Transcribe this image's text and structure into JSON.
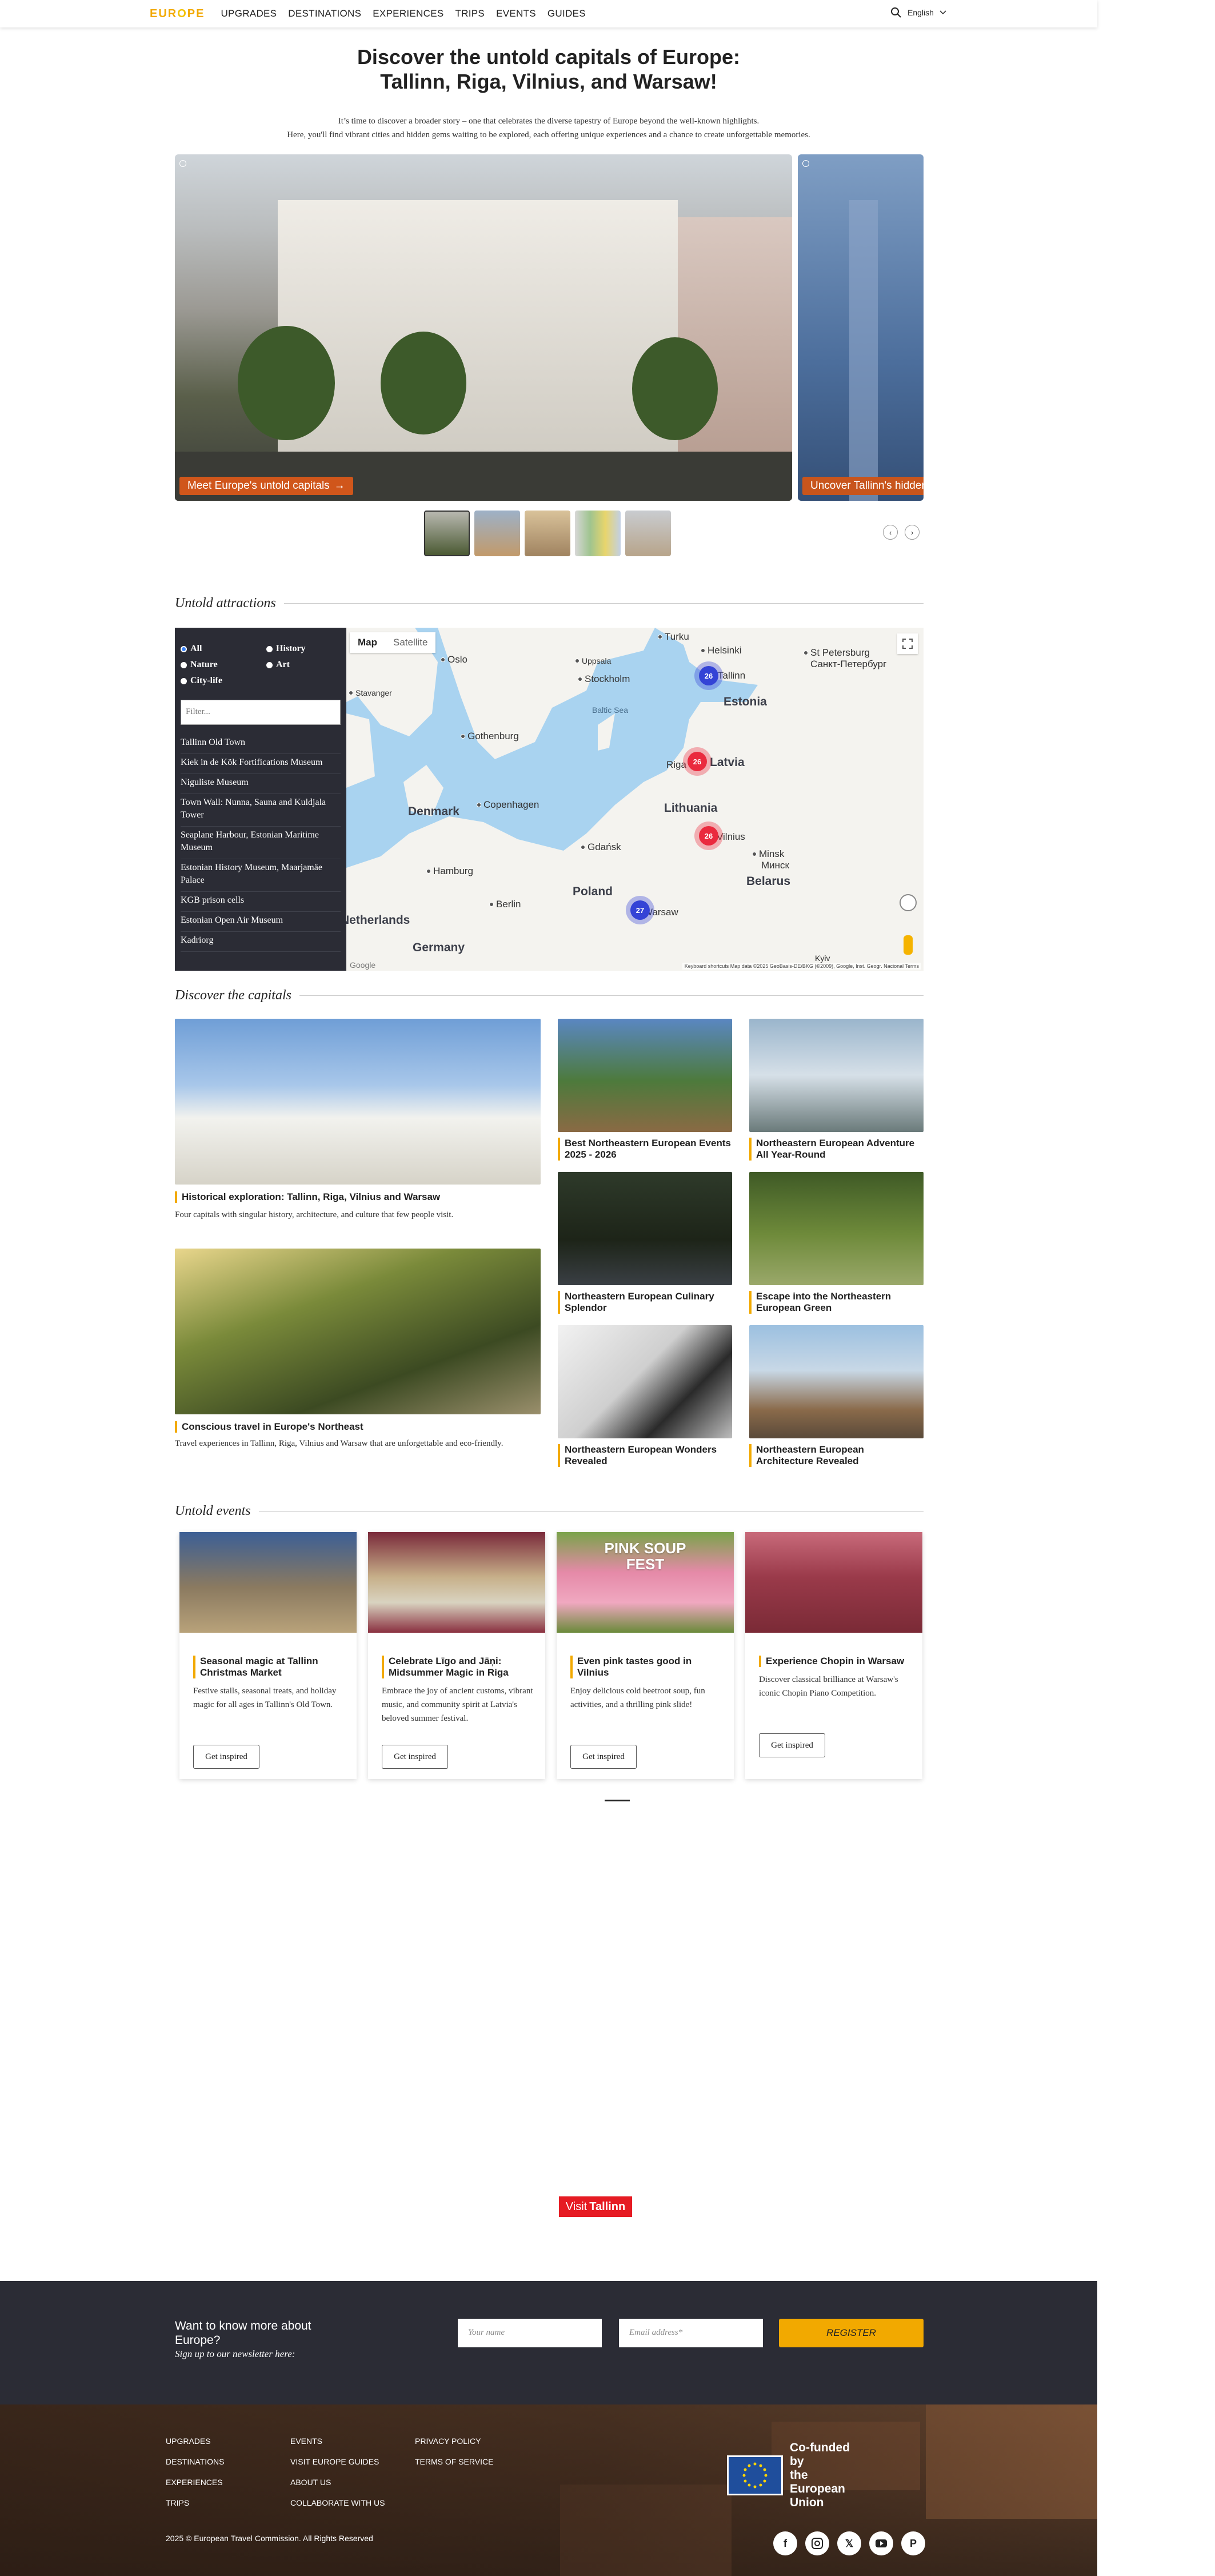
{
  "header": {
    "logo": "EUROPE",
    "nav": [
      "UPGRADES",
      "DESTINATIONS",
      "EXPERIENCES",
      "TRIPS",
      "EVENTS",
      "GUIDES"
    ],
    "language": "English"
  },
  "hero": {
    "title_line1": "Discover the untold capitals of Europe:",
    "title_line2": "Tallinn, Riga, Vilnius, and Warsaw!",
    "intro_line1": "It’s time to discover a broader story – one that celebrates the diverse tapestry of Europe beyond the well-known highlights.",
    "intro_line2": "Here, you'll find vibrant cities and hidden gems waiting to be explored, each offering unique experiences and a chance to create unforgettable memories.",
    "slides": [
      {
        "cta": "Meet Europe's untold capitals"
      },
      {
        "cta": "Uncover Tallinn's hidden gems"
      }
    ]
  },
  "attractions": {
    "heading": "Untold attractions",
    "filters": [
      "All",
      "History",
      "Nature",
      "Art",
      "City-life"
    ],
    "filter_selected": "All",
    "filter_placeholder": "Filter...",
    "list": [
      "Tallinn Old Town",
      "Kiek in de Kök Fortifications Museum",
      "Niguliste Museum",
      "Town Wall: Nunna, Sauna and Kuldjala Tower",
      "Seaplane Harbour, Estonian Maritime Museum",
      "Estonian History Museum, Maarjamäe Palace",
      "KGB prison cells",
      "Estonian Open Air Museum",
      "Kadriorg"
    ],
    "map": {
      "tabs": [
        "Map",
        "Satellite"
      ],
      "active_tab": "Map",
      "cities": [
        "Turku",
        "Helsinki",
        "St Petersburg",
        "Санкт-Петербург",
        "Oslo",
        "Uppsala",
        "Stockholm",
        "Stavanger",
        "Tallinn",
        "Gothenburg",
        "Riga",
        "Copenhagen",
        "Vilnius",
        "Minsk",
        "Минск",
        "Gdańsk",
        "Hamburg",
        "Berlin",
        "Warsaw",
        "Kyiv"
      ],
      "countries": [
        "Estonia",
        "Latvia",
        "Lithuania",
        "Denmark",
        "Poland",
        "Belarus",
        "Germany",
        "Netherlands"
      ],
      "seas": [
        "Baltic Sea"
      ],
      "clusters": [
        {
          "label": "26",
          "color": "blue"
        },
        {
          "label": "26",
          "color": "red"
        },
        {
          "label": "26",
          "color": "red"
        },
        {
          "label": "27",
          "color": "blue"
        }
      ],
      "credit": "Keyboard shortcuts   Map data ©2025 GeoBasis-DE/BKG (©2009), Google, Inst. Geogr. Nacional   Terms",
      "google_mark": "Google"
    }
  },
  "capitals": {
    "heading": "Discover the capitals",
    "features": [
      {
        "title": "Historical exploration: Tallinn, Riga, Vilnius and Warsaw",
        "desc": "Four capitals with singular history, architecture, and culture that few people visit."
      },
      {
        "title": "Conscious travel in Europe's Northeast",
        "desc": "Travel experiences in Tallinn, Riga, Vilnius and Warsaw that are unforgettable and eco-friendly."
      }
    ],
    "tiles": [
      {
        "title": "Best Northeastern European Events 2025 - 2026"
      },
      {
        "title": "Northeastern European Adventure All Year-Round"
      },
      {
        "title": "Northeastern European Culinary Splendor"
      },
      {
        "title": "Escape into the Northeastern European Green"
      },
      {
        "title": "Northeastern European Wonders Revealed"
      },
      {
        "title": "Northeastern European Architecture Revealed"
      }
    ]
  },
  "events": {
    "heading": "Untold events",
    "cards": [
      {
        "title": "Seasonal magic at Tallinn Christmas Market",
        "desc": "Festive stalls, seasonal treats, and holiday magic for all ages in Tallinn's Old Town.",
        "button": "Get inspired"
      },
      {
        "title": "Celebrate Līgo and Jāņi: Midsummer Magic in Riga",
        "desc": "Embrace the joy of ancient customs, vibrant music, and community spirit at Latvia's beloved summer festival.",
        "button": "Get inspired"
      },
      {
        "title": "Even pink tastes good in Vilnius",
        "desc": "Enjoy delicious cold beetroot soup, fun activities, and a thrilling pink slide!",
        "button": "Get inspired"
      },
      {
        "title": "Experience Chopin in Warsaw",
        "desc": "Discover classical brilliance at Warsaw's iconic Chopin Piano Competition.",
        "button": "Get inspired"
      }
    ],
    "pink_soup_sign": "PINK SOUP FEST"
  },
  "partner": {
    "visit": "Visit",
    "city": "Tallinn"
  },
  "newsletter": {
    "title": "Want to know more about Europe?",
    "subtitle": "Sign up to our newsletter here:",
    "name_placeholder": "Your name",
    "email_placeholder": "Email address*",
    "button": "REGISTER"
  },
  "footer": {
    "col1": [
      "UPGRADES",
      "DESTINATIONS",
      "EXPERIENCES",
      "TRIPS"
    ],
    "col2": [
      "EVENTS",
      "VISIT EUROPE GUIDES",
      "ABOUT US",
      "COLLABORATE WITH US"
    ],
    "col3": [
      "PRIVACY POLICY",
      "TERMS OF SERVICE"
    ],
    "eu_line1": "Co-funded by",
    "eu_line2": "the European Union",
    "copyright": "2025 © European Travel Commission. All Rights Reserved",
    "socials": [
      "facebook-icon",
      "instagram-icon",
      "x-icon",
      "youtube-icon",
      "pinterest-icon"
    ]
  },
  "colors": {
    "accent": "#f2a900",
    "dark": "#2b2c35",
    "cta": "#d0561b",
    "visit_red": "#e61b23"
  }
}
